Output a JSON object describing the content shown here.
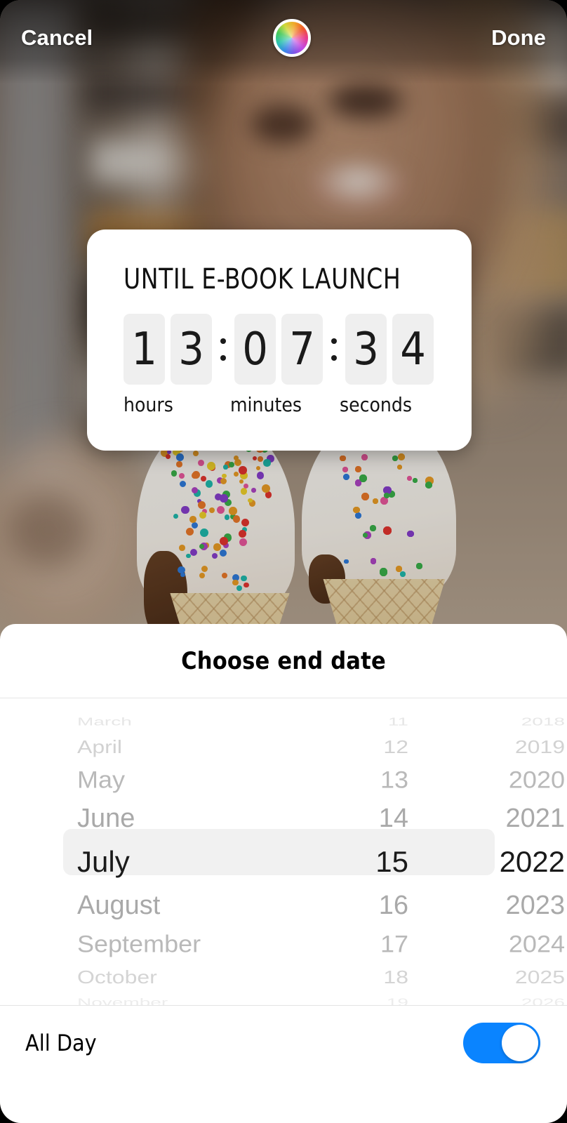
{
  "topbar": {
    "cancel_label": "Cancel",
    "done_label": "Done",
    "color_wheel_icon": "color-wheel-icon"
  },
  "countdown": {
    "title": "UNTIL E-BOOK LAUNCH",
    "hours_digits": [
      "1",
      "3"
    ],
    "minutes_digits": [
      "0",
      "7"
    ],
    "seconds_digits": [
      "3",
      "4"
    ],
    "hours_label": "hours",
    "minutes_label": "minutes",
    "seconds_label": "seconds",
    "separator": ":"
  },
  "sheet": {
    "title": "Choose end date",
    "picker": {
      "selected_index": 4,
      "rows": [
        {
          "month": "March",
          "day": "11",
          "year": "2018"
        },
        {
          "month": "April",
          "day": "12",
          "year": "2019"
        },
        {
          "month": "May",
          "day": "13",
          "year": "2020"
        },
        {
          "month": "June",
          "day": "14",
          "year": "2021"
        },
        {
          "month": "July",
          "day": "15",
          "year": "2022"
        },
        {
          "month": "August",
          "day": "16",
          "year": "2023"
        },
        {
          "month": "September",
          "day": "17",
          "year": "2024"
        },
        {
          "month": "October",
          "day": "18",
          "year": "2025"
        },
        {
          "month": "November",
          "day": "19",
          "year": "2026"
        }
      ]
    },
    "all_day": {
      "label": "All Day",
      "state": "on"
    }
  },
  "colors": {
    "accent_blue": "#0a84ff",
    "tile_gray": "#efefef",
    "selection_gray": "#f1f1f1",
    "sheet_white": "#ffffff"
  }
}
